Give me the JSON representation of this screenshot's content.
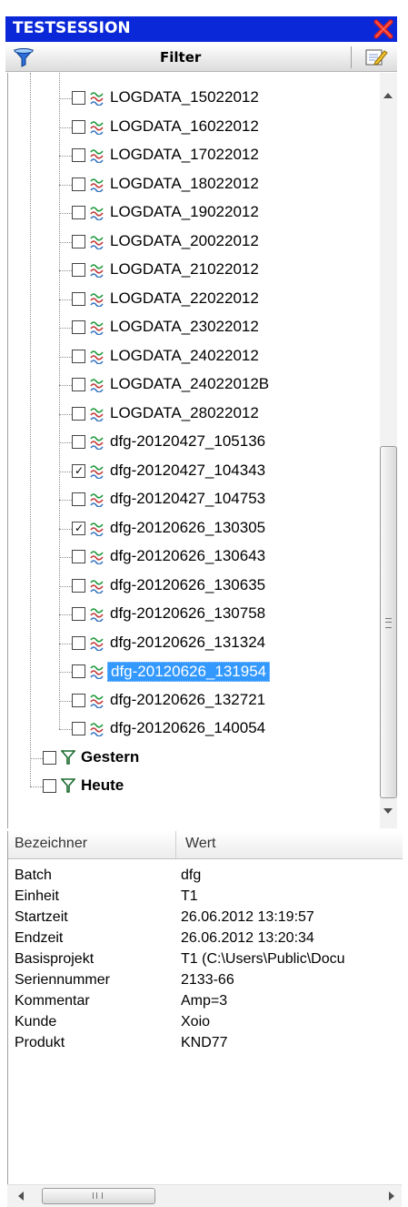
{
  "window": {
    "title": "TESTSESSION"
  },
  "toolbar": {
    "filter_label": "Filter"
  },
  "colors": {
    "title_bg": "#0a28d8",
    "selection": "#3399ff"
  },
  "tree": {
    "items": [
      {
        "label": "LOGDATA_15022012",
        "checked": false
      },
      {
        "label": "LOGDATA_16022012",
        "checked": false
      },
      {
        "label": "LOGDATA_17022012",
        "checked": false
      },
      {
        "label": "LOGDATA_18022012",
        "checked": false
      },
      {
        "label": "LOGDATA_19022012",
        "checked": false
      },
      {
        "label": "LOGDATA_20022012",
        "checked": false
      },
      {
        "label": "LOGDATA_21022012",
        "checked": false
      },
      {
        "label": "LOGDATA_22022012",
        "checked": false
      },
      {
        "label": "LOGDATA_23022012",
        "checked": false
      },
      {
        "label": "LOGDATA_24022012",
        "checked": false
      },
      {
        "label": "LOGDATA_24022012B",
        "checked": false
      },
      {
        "label": "LOGDATA_28022012",
        "checked": false
      },
      {
        "label": "dfg-20120427_105136",
        "checked": false
      },
      {
        "label": "dfg-20120427_104343",
        "checked": true
      },
      {
        "label": "dfg-20120427_104753",
        "checked": false
      },
      {
        "label": "dfg-20120626_130305",
        "checked": true
      },
      {
        "label": "dfg-20120626_130643",
        "checked": false
      },
      {
        "label": "dfg-20120626_130635",
        "checked": false
      },
      {
        "label": "dfg-20120626_130758",
        "checked": false
      },
      {
        "label": "dfg-20120626_131324",
        "checked": false
      },
      {
        "label": "dfg-20120626_131954",
        "checked": false,
        "selected": true
      },
      {
        "label": "dfg-20120626_132721",
        "checked": false
      },
      {
        "label": "dfg-20120626_140054",
        "checked": false
      }
    ],
    "groups": [
      {
        "label": "Gestern",
        "checked": false,
        "icon": "filter-funnel-icon"
      },
      {
        "label": "Heute",
        "checked": false,
        "icon": "filter-funnel-icon"
      }
    ],
    "checkmark": "✓",
    "item_icon": "signal-waves-icon"
  },
  "properties": {
    "header": {
      "name": "Bezeichner",
      "value": "Wert"
    },
    "rows": [
      {
        "name": "Batch",
        "value": "dfg"
      },
      {
        "name": "Einheit",
        "value": "T1"
      },
      {
        "name": "Startzeit",
        "value": "26.06.2012 13:19:57"
      },
      {
        "name": "Endzeit",
        "value": "26.06.2012 13:20:34"
      },
      {
        "name": "Basisprojekt",
        "value": "T1   (C:\\Users\\Public\\Docu"
      },
      {
        "name": "Seriennummer",
        "value": "2133-66"
      },
      {
        "name": "Kommentar",
        "value": "Amp=3"
      },
      {
        "name": "Kunde",
        "value": "Xoio"
      },
      {
        "name": "Produkt",
        "value": "KND77"
      }
    ]
  }
}
